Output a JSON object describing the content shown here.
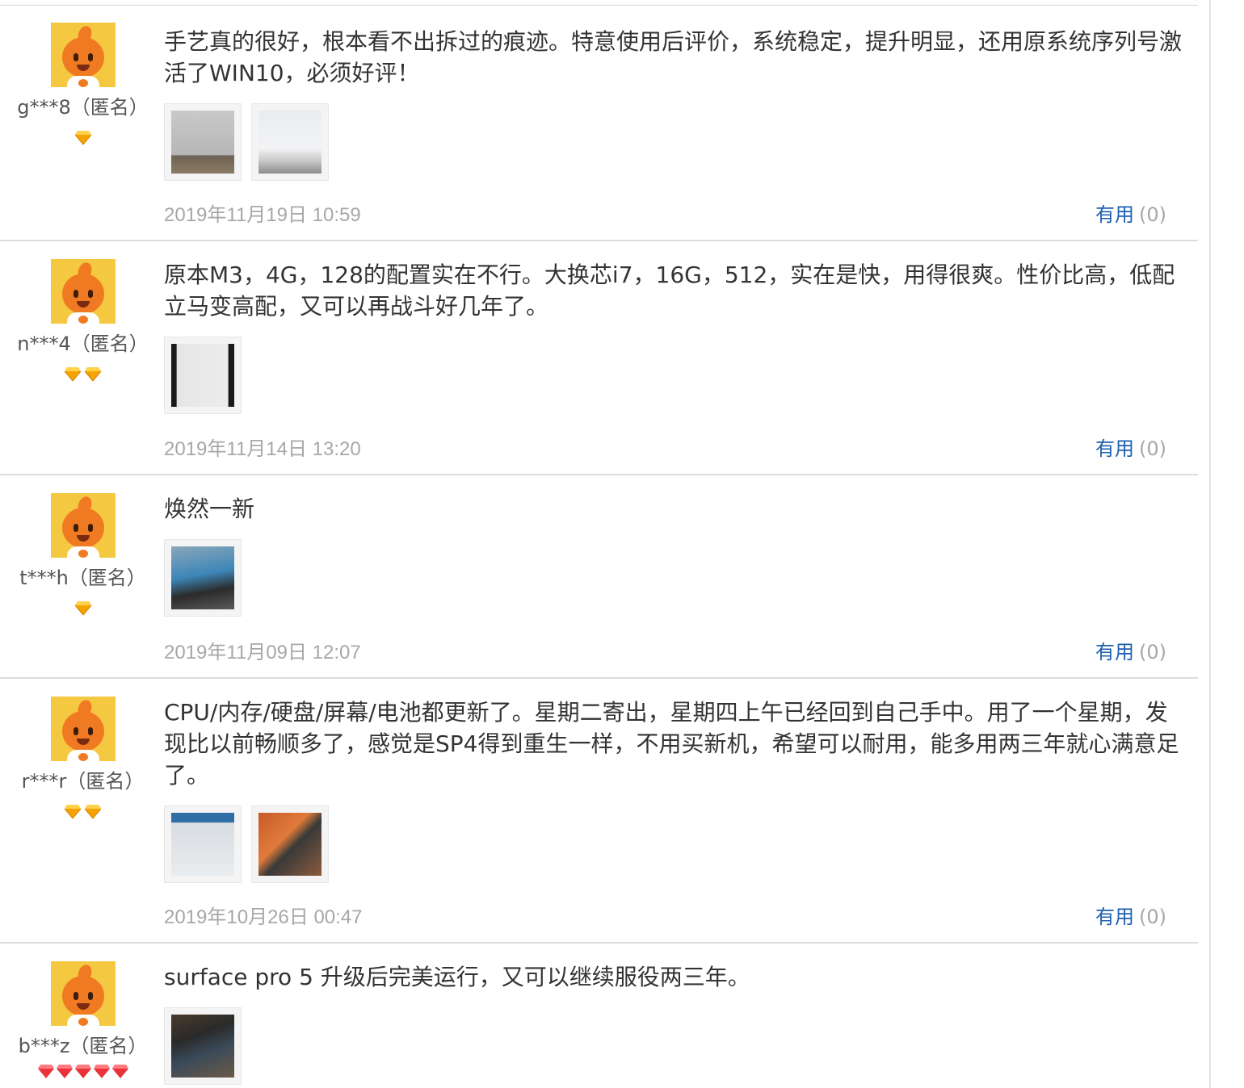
{
  "reviews": [
    {
      "user": "g***8（匿名）",
      "level": 1,
      "badge_color": "#f5a300",
      "text": "手艺真的很好，根本看不出拆过的痕迹。特意使用后评价，系统稳定，提升明显，还用原系统序列号激活了WIN10，必须好评！",
      "photo_count": 2,
      "date": "2019年11月19日 10:59",
      "useful_label": "有用",
      "useful_count": "(0)"
    },
    {
      "user": "n***4（匿名）",
      "level": 2,
      "badge_color": "#f5a300",
      "text": "原本M3，4G，128的配置实在不行。大换芯i7，16G，512，实在是快，用得很爽。性价比高，低配立马变高配，又可以再战斗好几年了。",
      "photo_count": 1,
      "date": "2019年11月14日 13:20",
      "useful_label": "有用",
      "useful_count": "(0)"
    },
    {
      "user": "t***h（匿名）",
      "level": 1,
      "badge_color": "#f5a300",
      "text": "焕然一新",
      "photo_count": 1,
      "date": "2019年11月09日 12:07",
      "useful_label": "有用",
      "useful_count": "(0)"
    },
    {
      "user": "r***r（匿名）",
      "level": 2,
      "badge_color": "#f5a300",
      "text": "CPU/内存/硬盘/屏幕/电池都更新了。星期二寄出，星期四上午已经回到自己手中。用了一个星期，发现比以前畅顺多了，感觉是SP4得到重生一样，不用买新机，希望可以耐用，能多用两三年就心满意足了。",
      "photo_count": 2,
      "date": "2019年10月26日 00:47",
      "useful_label": "有用",
      "useful_count": "(0)"
    },
    {
      "user": "b***z（匿名）",
      "level": 5,
      "badge_color": "#e8333a",
      "text": "surface pro 5 升级后完美运行，又可以继续服役两三年。",
      "photo_count": 1,
      "date": "",
      "useful_label": "",
      "useful_count": ""
    }
  ]
}
